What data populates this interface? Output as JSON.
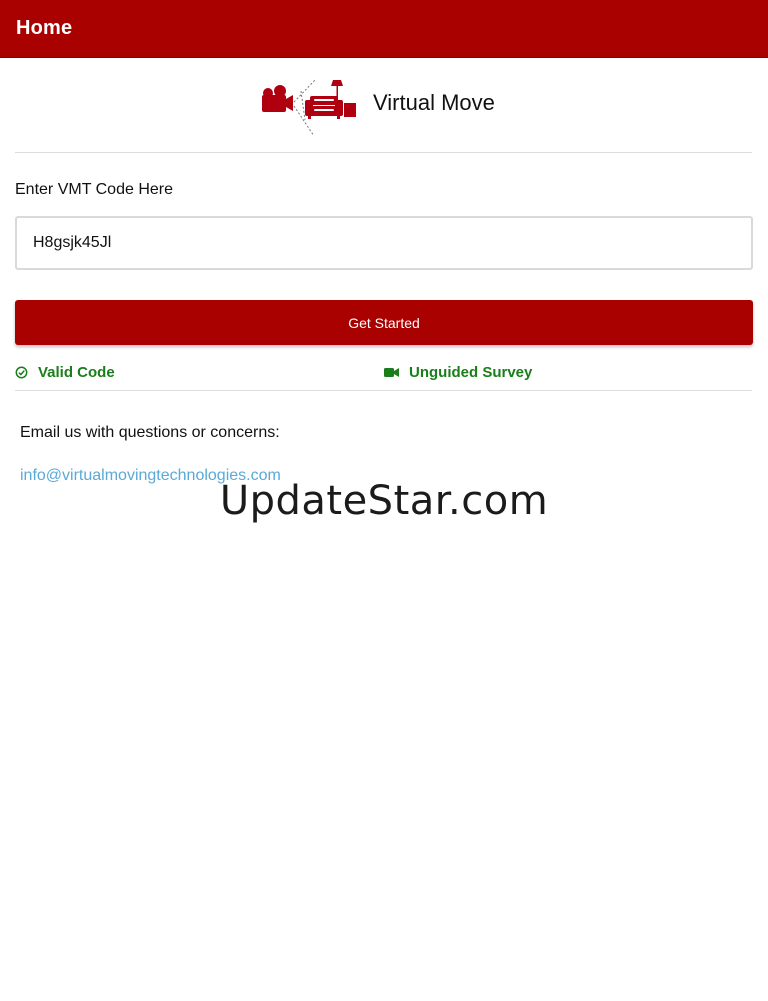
{
  "app_bar": {
    "title": "Home",
    "color": "#a90000"
  },
  "brand": {
    "name": "Virtual Move",
    "logo_icon": "camera-couch-logo-icon"
  },
  "form": {
    "label": "Enter VMT Code Here",
    "code_value": "H8gsjk45Jl",
    "button_label": "Get Started"
  },
  "status": {
    "valid_label": "Valid Code",
    "valid_icon": "check-circle-icon",
    "survey_label": "Unguided Survey",
    "survey_icon": "video-camera-icon",
    "color": "#1a7f1a"
  },
  "contact": {
    "text": "Email us with questions or concerns:",
    "email": "info@virtualmovingtechnologies.com"
  },
  "watermark": "UpdateStar.com"
}
